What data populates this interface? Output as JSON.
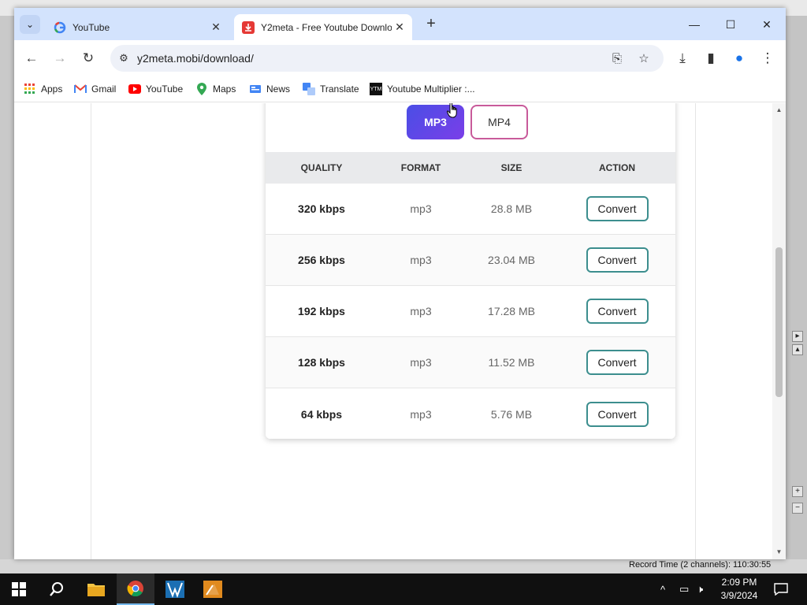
{
  "background_app": {
    "status_text": "Record Time (2 channels): 110:30:55"
  },
  "browser": {
    "tabs": [
      {
        "title": "YouTube",
        "active": false,
        "favicon": "google-g-icon"
      },
      {
        "title": "Y2meta - Free Youtube Downlo",
        "active": true,
        "favicon": "y2meta-download-icon"
      }
    ],
    "url": "y2meta.mobi/download/",
    "bookmarks": [
      {
        "label": "Apps",
        "icon": "apps-grid-icon"
      },
      {
        "label": "Gmail",
        "icon": "gmail-icon"
      },
      {
        "label": "YouTube",
        "icon": "youtube-icon"
      },
      {
        "label": "Maps",
        "icon": "maps-icon"
      },
      {
        "label": "News",
        "icon": "news-icon"
      },
      {
        "label": "Translate",
        "icon": "translate-icon"
      },
      {
        "label": "Youtube Multiplier :...",
        "icon": "ytm-icon"
      }
    ]
  },
  "page": {
    "format_buttons": [
      {
        "label": "MP3",
        "active": true
      },
      {
        "label": "MP4",
        "active": false
      }
    ],
    "table": {
      "headers": [
        "QUALITY",
        "FORMAT",
        "SIZE",
        "ACTION"
      ],
      "rows": [
        {
          "quality": "320 kbps",
          "format": "mp3",
          "size": "28.8 MB",
          "action": "Convert"
        },
        {
          "quality": "256 kbps",
          "format": "mp3",
          "size": "23.04 MB",
          "action": "Convert"
        },
        {
          "quality": "192 kbps",
          "format": "mp3",
          "size": "17.28 MB",
          "action": "Convert"
        },
        {
          "quality": "128 kbps",
          "format": "mp3",
          "size": "11.52 MB",
          "action": "Convert"
        },
        {
          "quality": "64 kbps",
          "format": "mp3",
          "size": "5.76 MB",
          "action": "Convert"
        }
      ]
    }
  },
  "taskbar": {
    "clock_time": "2:09 PM",
    "clock_date": "3/9/2024"
  },
  "colors": {
    "tabstrip": "#d3e3fd",
    "mp3_button": "#5a45e8",
    "mp4_border": "#c85a9a",
    "convert_border": "#3c8e8e"
  }
}
